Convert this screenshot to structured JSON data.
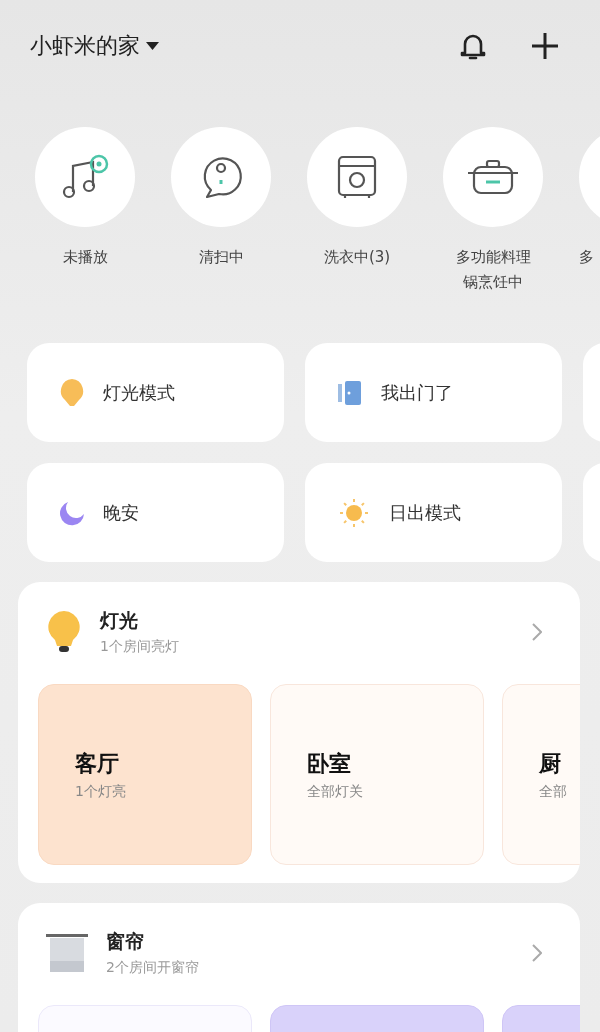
{
  "header": {
    "title": "小虾米的家"
  },
  "devices": [
    {
      "kind": "music",
      "lines": [
        "未播放"
      ]
    },
    {
      "kind": "vacuum",
      "lines": [
        "清扫中"
      ]
    },
    {
      "kind": "washer",
      "lines": [
        "洗衣中(3)"
      ]
    },
    {
      "kind": "cooker",
      "lines": [
        "多功能料理",
        "锅烹饪中"
      ]
    },
    {
      "kind": "offscreen",
      "lines": [
        "多"
      ]
    }
  ],
  "scenes": [
    [
      {
        "kind": "bulb",
        "label": "灯光模式"
      },
      {
        "kind": "door",
        "label": "我出门了"
      },
      {
        "kind": "blank"
      }
    ],
    [
      {
        "kind": "moon",
        "label": "晚安"
      },
      {
        "kind": "sun",
        "label": "日出模式"
      },
      {
        "kind": "blank"
      }
    ]
  ],
  "groups": [
    {
      "kind": "light",
      "title": "灯光",
      "subtitle": "1个房间亮灯",
      "rooms": [
        {
          "name": "客厅",
          "status": "1个灯亮",
          "on": true
        },
        {
          "name": "卧室",
          "status": "全部灯关",
          "on": false
        },
        {
          "name": "厨",
          "status": "全部",
          "on": false
        }
      ]
    },
    {
      "kind": "curtain",
      "title": "窗帘",
      "subtitle": "2个房间开窗帘",
      "rooms": [
        {
          "on": false
        },
        {
          "on": true
        },
        {
          "on": true
        }
      ]
    }
  ]
}
